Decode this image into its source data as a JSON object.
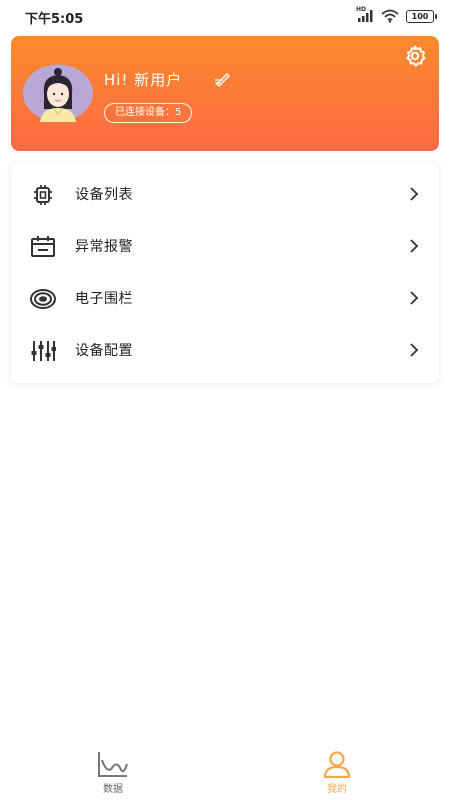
{
  "status_bar": {
    "time": "下午5:05",
    "signal_label": "HD",
    "battery": "100"
  },
  "profile": {
    "greeting": "Hi!  新用户",
    "connected_devices": "已连接设备：5"
  },
  "menu": {
    "items": [
      {
        "label": "设备列表",
        "icon": "device-icon"
      },
      {
        "label": "异常报警",
        "icon": "alarm-calendar-icon"
      },
      {
        "label": "电子围栏",
        "icon": "geofence-icon"
      },
      {
        "label": "设备配置",
        "icon": "sliders-icon"
      }
    ]
  },
  "tabs": [
    {
      "label": "数据",
      "icon": "line-chart-icon",
      "active": false
    },
    {
      "label": "我的",
      "icon": "user-icon",
      "active": true
    }
  ],
  "colors": {
    "accent": "#f9a64a",
    "card_gradient_top": "#f98b2c",
    "card_gradient_bottom": "#ff6a45",
    "inactive_tab": "#666666"
  }
}
